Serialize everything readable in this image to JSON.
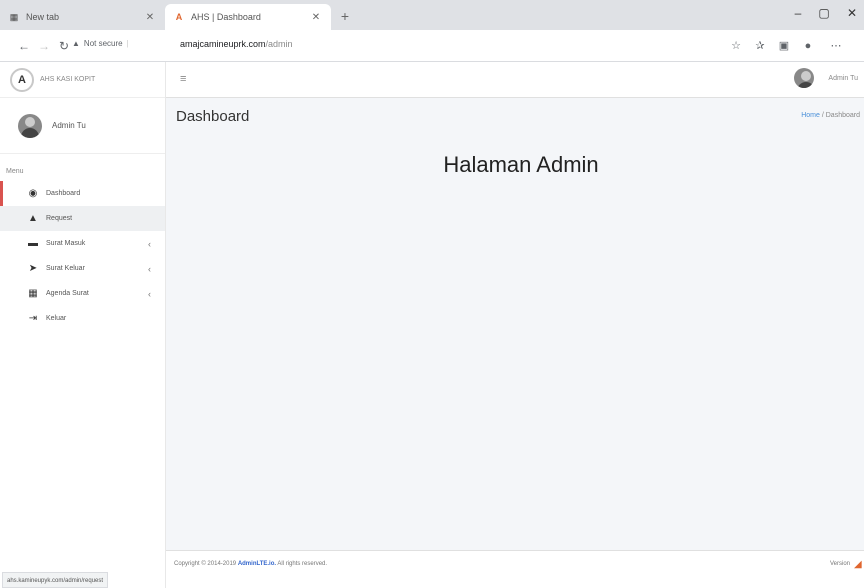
{
  "browser": {
    "tabs": [
      {
        "title": "New tab",
        "icon": "grid-icon"
      },
      {
        "title": "AHS | Dashboard",
        "icon": "app-favicon"
      }
    ],
    "new_tab_label": "+",
    "window_controls": {
      "minimize": "–",
      "maximize": "▢",
      "close": "✕"
    },
    "security_label": "Not secure",
    "url_host": "amajcamineuprk.com",
    "url_path": "/admin",
    "status_url": "ahs.kamineupyk.com/admin/request"
  },
  "sidebar": {
    "brand_logo": "A",
    "brand_text": "AHS KASI KOPIT",
    "user_name": "Admin Tu",
    "menu_header": "Menu",
    "items": [
      {
        "label": "Dashboard",
        "icon": "dashboard-icon",
        "glyph": "◉",
        "arrow": ""
      },
      {
        "label": "Request",
        "icon": "bell-icon",
        "glyph": "▲",
        "arrow": ""
      },
      {
        "label": "Surat Masuk",
        "icon": "inbox-icon",
        "glyph": "▬",
        "arrow": "‹"
      },
      {
        "label": "Surat Keluar",
        "icon": "send-icon",
        "glyph": "➤",
        "arrow": "‹"
      },
      {
        "label": "Agenda Surat",
        "icon": "book-icon",
        "glyph": "▦",
        "arrow": "‹"
      },
      {
        "label": "Keluar",
        "icon": "logout-icon",
        "glyph": "⇥",
        "arrow": ""
      }
    ]
  },
  "topnav": {
    "menu_icon": "≡",
    "user_name": "Admin Tu"
  },
  "content": {
    "page_title": "Dashboard",
    "breadcrumb": {
      "home": "Home",
      "separator": "/",
      "current": "Dashboard"
    },
    "heading": "Halaman Admin"
  },
  "footer": {
    "copyright_prefix": "Copyright © 2014-2019",
    "copyright_brand": "AdminLTE.io.",
    "copyright_suffix": "All rights reserved.",
    "version_label": "Version"
  },
  "colors": {
    "active_accent": "#d9534f",
    "link": "#4a90d9",
    "content_bg": "#f4f6f9"
  }
}
